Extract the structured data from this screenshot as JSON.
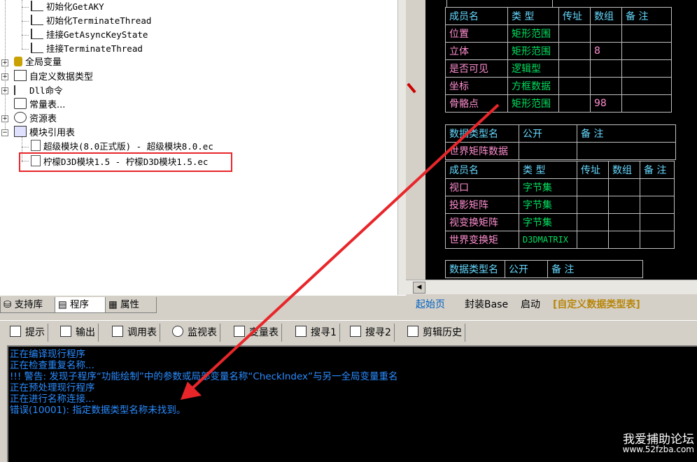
{
  "tree": {
    "items": [
      {
        "label": "初始化GetAKY"
      },
      {
        "label": "初始化TerminateThread"
      },
      {
        "label": "挂接GetAsyncKeyState"
      },
      {
        "label": "挂接TerminateThread"
      },
      {
        "label": "全局变量"
      },
      {
        "label": "自定义数据类型"
      },
      {
        "label": "Dll命令"
      },
      {
        "label": "常量表..."
      },
      {
        "label": "资源表"
      },
      {
        "label": "模块引用表"
      },
      {
        "label": "超级模块(8.0正式版) - 超级模块8.0.ec"
      },
      {
        "label": "柠檬D3D模块1.5 - 柠檬D3D模块1.5.ec"
      }
    ]
  },
  "left_tabs": [
    "支持库",
    "程序",
    "属性"
  ],
  "code": {
    "table1": {
      "header": [
        "成员名",
        "类 型",
        "传址",
        "数组",
        "备 注"
      ],
      "rows": [
        [
          "位置",
          "矩形范围",
          "",
          "",
          ""
        ],
        [
          "立体",
          "矩形范围",
          "",
          "8",
          ""
        ],
        [
          "是否可见",
          "逻辑型",
          "",
          "",
          ""
        ],
        [
          "坐标",
          "方框数据",
          "",
          "",
          ""
        ],
        [
          "骨骼点",
          "矩形范围",
          "",
          "98",
          ""
        ]
      ]
    },
    "table2": {
      "type_header": [
        "数据类型名",
        "公开",
        "备 注"
      ],
      "type_name": "世界矩阵数据",
      "member_header": [
        "成员名",
        "类 型",
        "传址",
        "数组",
        "备 注"
      ],
      "rows": [
        [
          "视口",
          "字节集"
        ],
        [
          "投影矩阵",
          "字节集"
        ],
        [
          "视变换矩阵",
          "字节集"
        ],
        [
          "世界变换矩",
          "D3DMATRIX"
        ]
      ]
    },
    "table3": {
      "type_header": [
        "数据类型名",
        "公开",
        "备 注"
      ]
    }
  },
  "right_tabs": [
    "起始页",
    "封装Base",
    "启动",
    "[自定义数据类型表]"
  ],
  "bottom_tabs": [
    "提示",
    "输出",
    "调用表",
    "监视表",
    "变量表",
    "搜寻1",
    "搜寻2",
    "剪辑历史"
  ],
  "console": {
    "lines": [
      "正在编译现行程序",
      "正在检查重复名称...",
      "!!! 警告: 发现子程序“功能绘制”中的参数或局部变量名称“CheckIndex”与另一全局变量重名",
      "正在预处理现行程序",
      "正在进行名称连接...",
      "错误(10001): 指定数据类型名称未找到。"
    ]
  },
  "watermark": {
    "line1": "我爱捕助论坛",
    "line2": "www.52fzba.com"
  },
  "colors": {
    "highlight": "#e8262a",
    "console_text": "#2a8cff",
    "type_text": "#00e060",
    "header_text": "#66d9ff"
  }
}
